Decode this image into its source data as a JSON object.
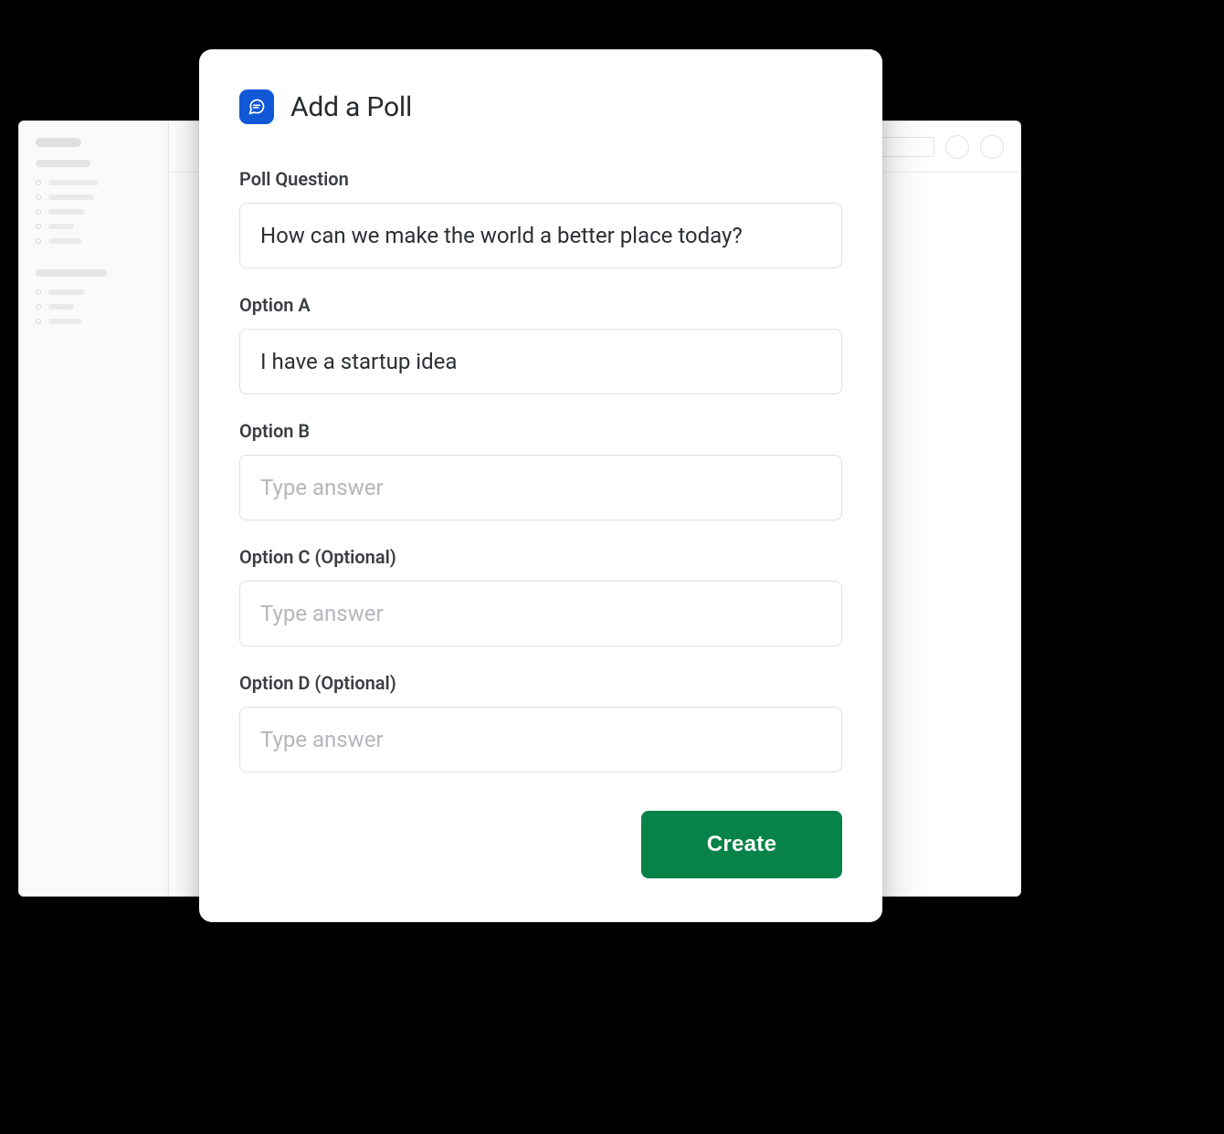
{
  "modal": {
    "title": "Add a Poll",
    "question_label": "Poll Question",
    "question_value": "How can we make the world a better place today?",
    "options": [
      {
        "label": "Option A",
        "value": "I have a startup idea",
        "placeholder": "Type answer"
      },
      {
        "label": "Option B",
        "value": "",
        "placeholder": "Type answer"
      },
      {
        "label": "Option C (Optional)",
        "value": "",
        "placeholder": "Type answer"
      },
      {
        "label": "Option D (Optional)",
        "value": "",
        "placeholder": "Type answer"
      }
    ],
    "create_button": "Create"
  }
}
